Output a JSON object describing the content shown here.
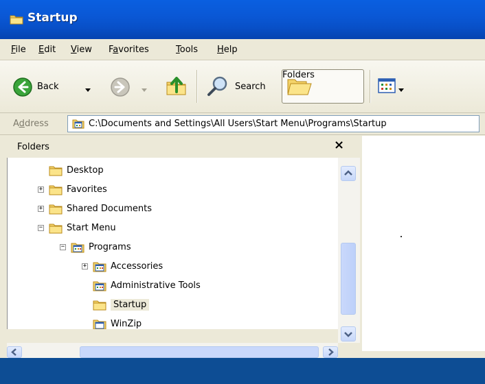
{
  "window": {
    "title": "Startup"
  },
  "menubar": {
    "items": [
      {
        "prefix": "",
        "key": "F",
        "rest": "ile"
      },
      {
        "prefix": "",
        "key": "E",
        "rest": "dit"
      },
      {
        "prefix": "",
        "key": "V",
        "rest": "iew"
      },
      {
        "prefix": "F",
        "key": "a",
        "rest": "vorites"
      },
      {
        "prefix": "",
        "key": "T",
        "rest": "ools"
      },
      {
        "prefix": "",
        "key": "H",
        "rest": "elp"
      }
    ]
  },
  "toolbar": {
    "back_label": "Back",
    "search_label": "Search",
    "folders_label": "Folders"
  },
  "address": {
    "label_prefix": "A",
    "label_key": "d",
    "label_rest": "dress",
    "path": "C:\\Documents and Settings\\All Users\\Start Menu\\Programs\\Startup"
  },
  "folders_pane": {
    "title": "Folders",
    "close_glyph": "×",
    "tree": [
      {
        "label": "Desktop",
        "expander": ""
      },
      {
        "label": "Favorites",
        "expander": "+"
      },
      {
        "label": "Shared Documents",
        "expander": "+"
      },
      {
        "label": "Start Menu",
        "expander": "−"
      },
      {
        "label": "Programs",
        "expander": "−"
      },
      {
        "label": "Accessories",
        "expander": "+"
      },
      {
        "label": "Administrative Tools",
        "expander": ""
      },
      {
        "label": "Startup",
        "expander": "",
        "selected": true
      },
      {
        "label": "WinZip",
        "expander": ""
      }
    ]
  },
  "colors": {
    "titlebar": "#0a58d6",
    "window_bg": "#ece9d8",
    "taskbar": "#0d4d94",
    "folder_yellow": "#f4d36a"
  }
}
